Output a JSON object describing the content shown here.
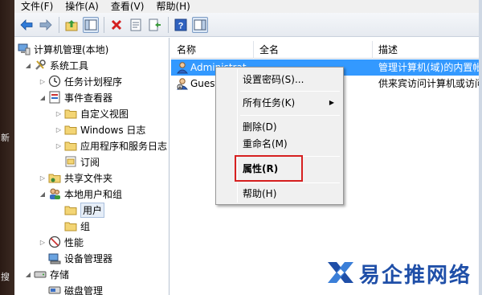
{
  "desktop": {
    "chars": [
      "新",
      "搜"
    ]
  },
  "menubar": {
    "items": [
      "文件(F)",
      "操作(A)",
      "查看(V)",
      "帮助(H)"
    ]
  },
  "toolbar": {
    "buttons": [
      "back-arrow-icon",
      "forward-arrow-icon",
      "up-folder-icon",
      "show-tree-icon",
      "delete-icon",
      "properties-icon",
      "export-icon",
      "help-icon",
      "action-pane-icon"
    ]
  },
  "tree": {
    "root": "计算机管理(本地)",
    "system_tools": "系统工具",
    "task_scheduler": "任务计划程序",
    "event_viewer": "事件查看器",
    "custom_views": "自定义视图",
    "windows_logs": "Windows 日志",
    "app_service_logs": "应用程序和服务日志",
    "subscriptions": "订阅",
    "shared_folders": "共享文件夹",
    "local_users_groups": "本地用户和组",
    "users": "用户",
    "groups": "组",
    "performance": "性能",
    "device_manager": "设备管理器",
    "storage": "存储",
    "disk_management": "磁盘管理"
  },
  "list": {
    "columns": [
      "名称",
      "全名",
      "描述"
    ],
    "rows": [
      {
        "name": "Administrat",
        "fullname": "",
        "description": "管理计算机(域)的内置帐"
      },
      {
        "name": "Guest",
        "fullname": "",
        "description": "供来宾访问计算机或访问"
      }
    ]
  },
  "context_menu": {
    "set_password": "设置密码(S)...",
    "all_tasks": "所有任务(K)",
    "delete": "删除(D)",
    "rename": "重命名(M)",
    "properties": "属性(R)",
    "help": "帮助(H)"
  },
  "watermark": {
    "text": "易企推网络"
  },
  "colors": {
    "selection": "#3399ff",
    "highlight_box": "#d62020",
    "watermark": "#1f4fa8"
  }
}
